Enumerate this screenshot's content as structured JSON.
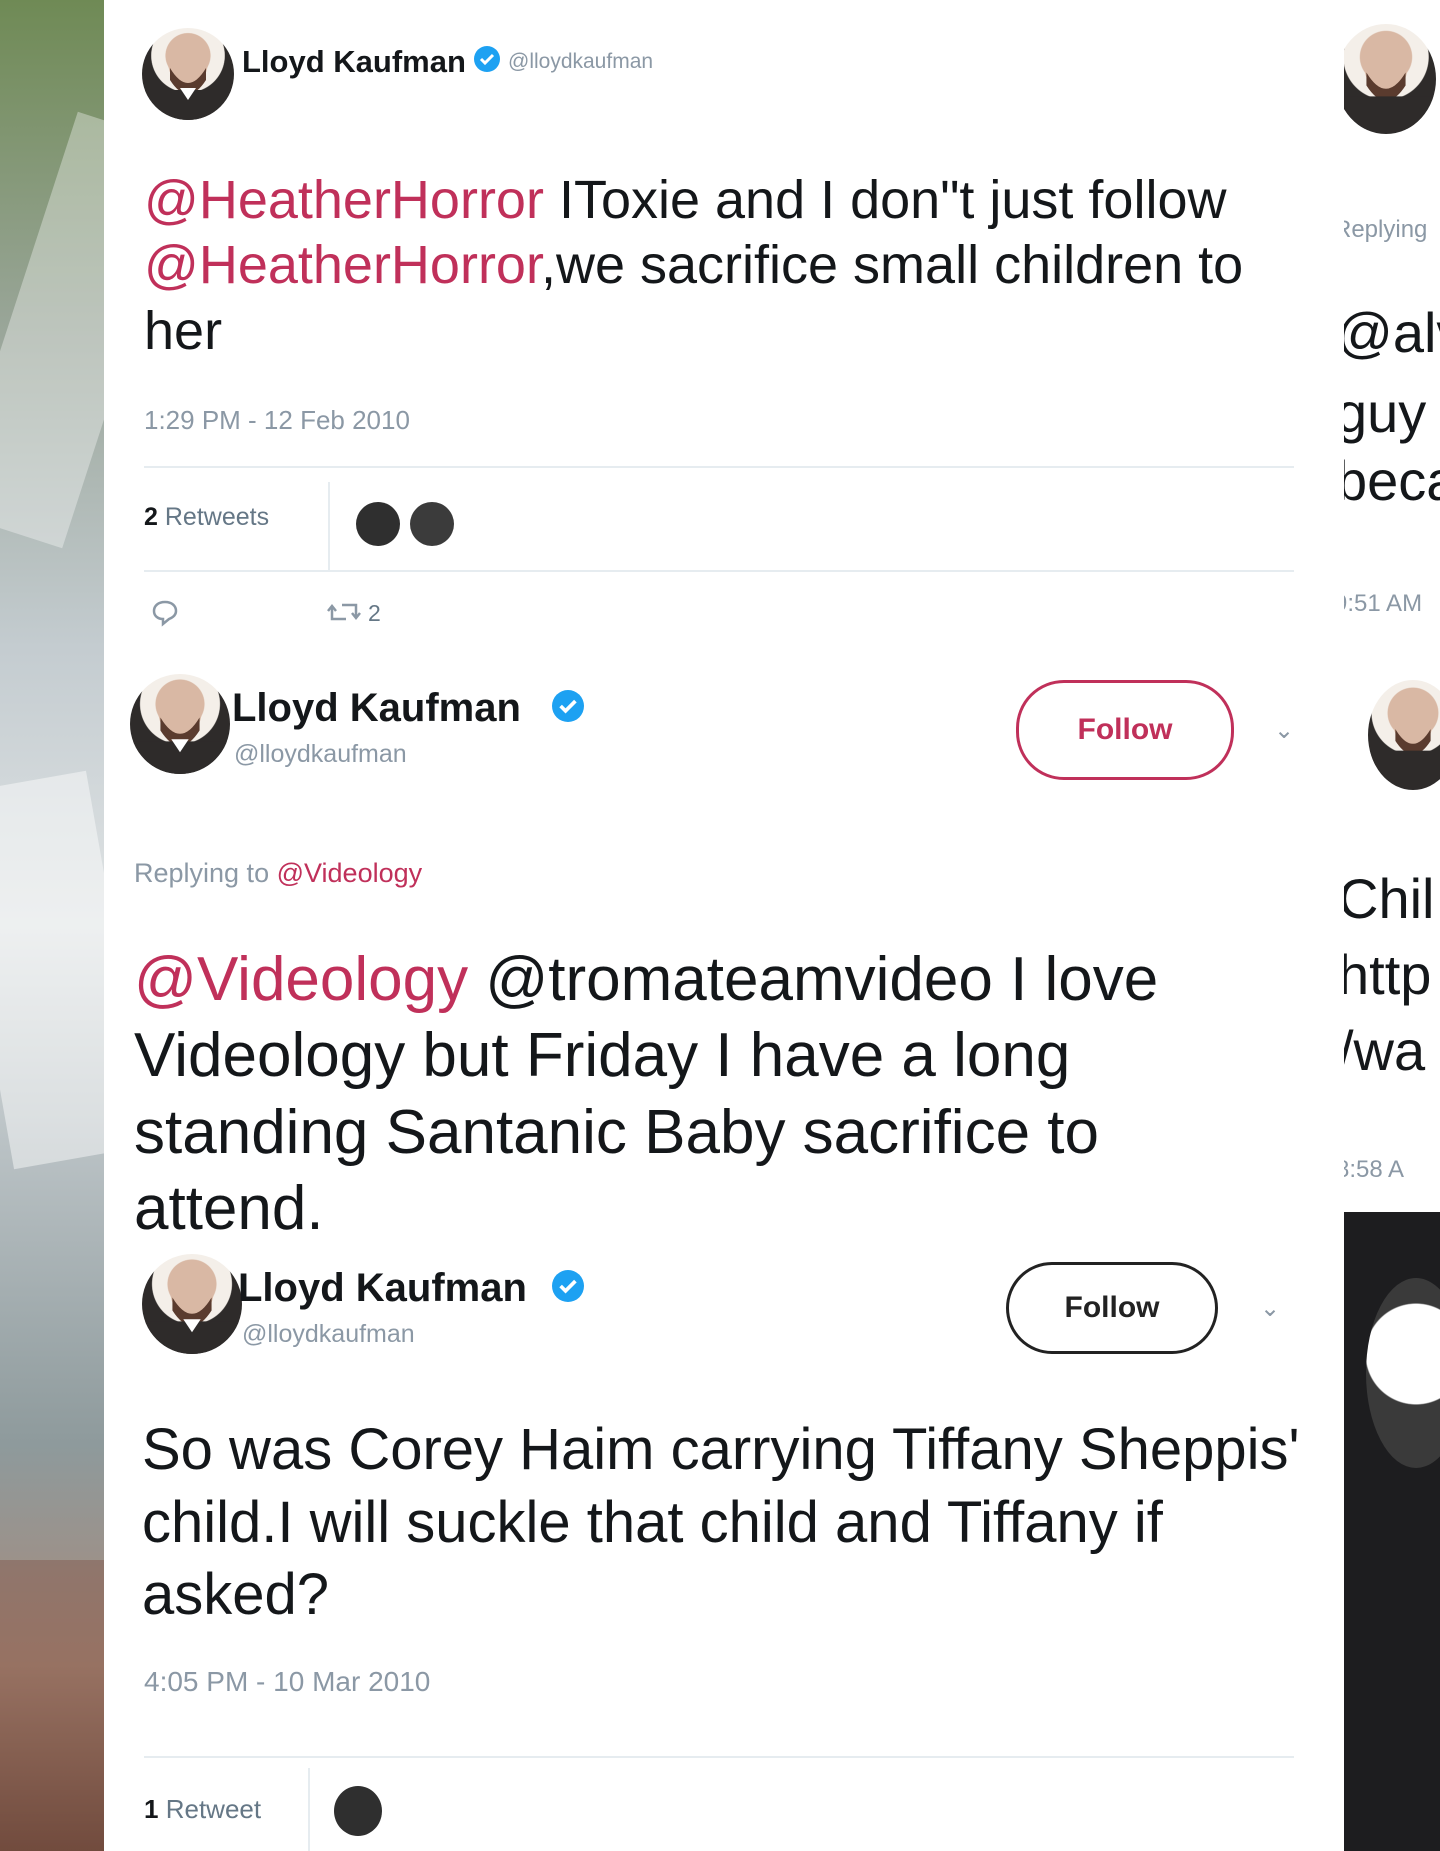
{
  "tweets": [
    {
      "name": "Lloyd Kaufman",
      "handle": "@lloydkaufman",
      "text_parts": {
        "mention1": "@HeatherHorror",
        "t1": " IToxie and I don\"t just follow ",
        "mention2": "@HeatherHorror",
        "t2": ",we sacrifice small children to her"
      },
      "timestamp": "1:29 PM - 12 Feb 2010",
      "retweets_count": "2",
      "retweets_label": "Retweets",
      "retweet_action_count": "2"
    },
    {
      "name": "Lloyd Kaufman",
      "handle": "@lloydkaufman",
      "follow_label": "Follow",
      "reply_prefix": "Replying to",
      "reply_handle": "@Videology",
      "text_parts": {
        "mention1": "@Videology",
        "t1": " @tromateamvideo I love Videology but Friday I have a long standing Santanic Baby sacrifice to attend."
      }
    },
    {
      "name": "Lloyd Kaufman",
      "handle": "@lloydkaufman",
      "follow_label": "Follow",
      "text": "So was Corey Haim carrying Tiffany Sheppis' child.I will suckle that child and Tiffany if asked?",
      "timestamp": "4:05 PM - 10 Mar 2010",
      "retweets_count": "1",
      "retweets_label": "Retweet"
    }
  ],
  "right_column": {
    "replying_fragment": "Replying",
    "text_line1": "@alv",
    "text_line2": "guy",
    "text_line3": "beca",
    "timestamp1": "9:51 AM",
    "text2_line1": "Chil",
    "text2_line2": "http",
    "text2_line3": "/wa",
    "timestamp2": "8:58 A"
  },
  "icons": {
    "reply": "reply-icon",
    "retweet": "retweet-icon",
    "verified": "verified-badge-icon",
    "chevron": "chevron-down-icon"
  },
  "colors": {
    "mention": "#c0305a",
    "follow_pink": "#c0305a",
    "verified": "#1da1f2",
    "muted": "#8b98a5"
  }
}
